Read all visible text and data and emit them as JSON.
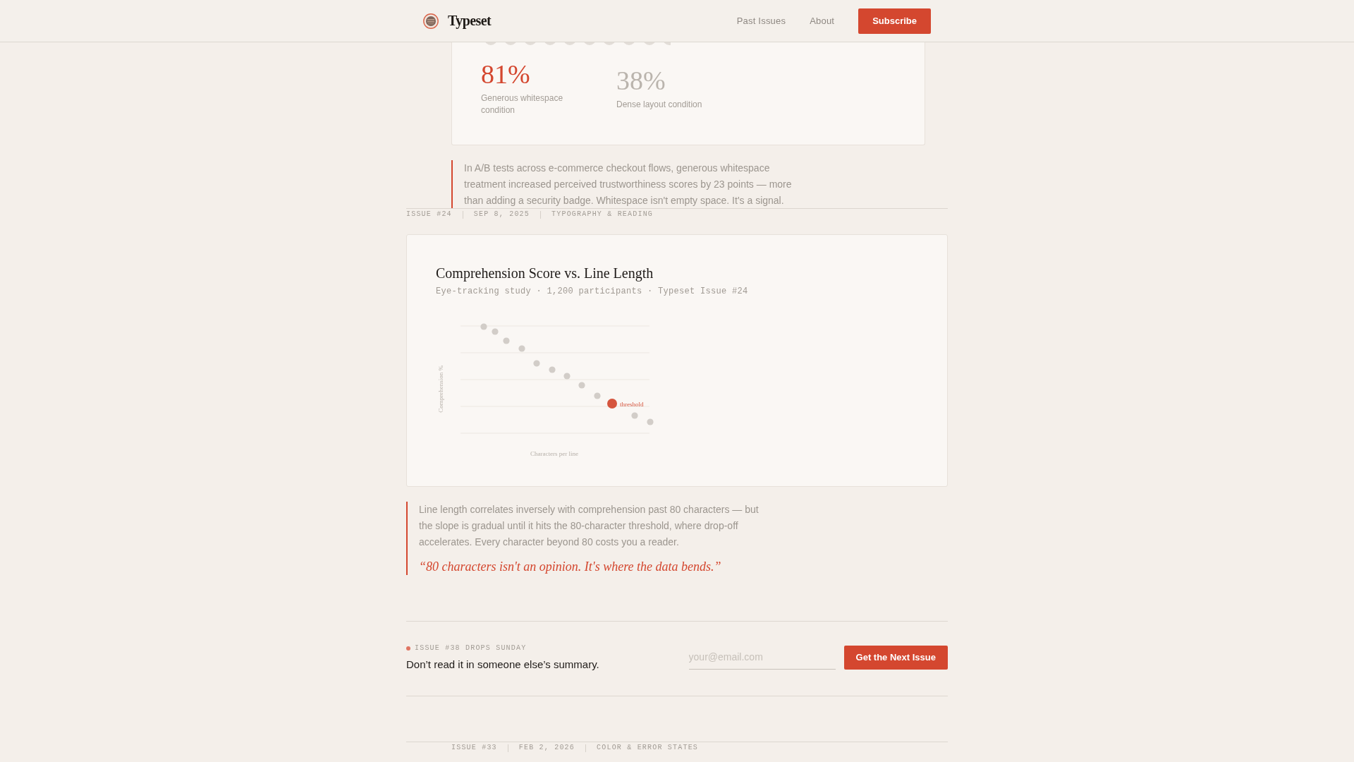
{
  "header": {
    "brand": "Typeset",
    "nav": [
      "Past Issues",
      "About"
    ],
    "cta": "Subscribe"
  },
  "stats_card": {
    "stats": [
      {
        "value": "81%",
        "label": "Generous whitespace condition",
        "highlighted": true
      },
      {
        "value": "38%",
        "label": "Dense layout condition",
        "highlighted": false
      }
    ]
  },
  "callout": "In A/B tests across e-commerce checkout flows, generous whitespace treatment increased perceived trustworthiness scores by 23 points — more than adding a security badge. Whitespace isn't empty space. It's a signal.",
  "issue_meta": [
    "ISSUE #24",
    "SEP 8, 2025",
    "TYPOGRAPHY & READING"
  ],
  "chart_card": {
    "title": "Comprehension Score vs. Line Length",
    "subtitle": "Eye-tracking study · 1,200 participants · Typeset Issue #24",
    "y_axis_label": "Comprehension %",
    "x_axis_label": "Characters per line",
    "annotation": "threshold"
  },
  "insight": {
    "text": "Line length correlates inversely with comprehension past 80 characters — but the slope is gradual until it hits the 80-character threshold, where drop-off accelerates. Every character beyond 80 costs you a reader.",
    "quote": "“80 characters isn't an opinion. It's where the data bends.”"
  },
  "signup": {
    "eyebrow": "ISSUE #38 DROPS SUNDAY",
    "headline": "Don’t read it in someone else’s summary.",
    "email_placeholder": "your@email.com",
    "button": "Get the Next Issue"
  },
  "next_issue_meta": [
    "ISSUE #33",
    "FEB 2, 2026",
    "COLOR & ERROR STATES"
  ]
}
